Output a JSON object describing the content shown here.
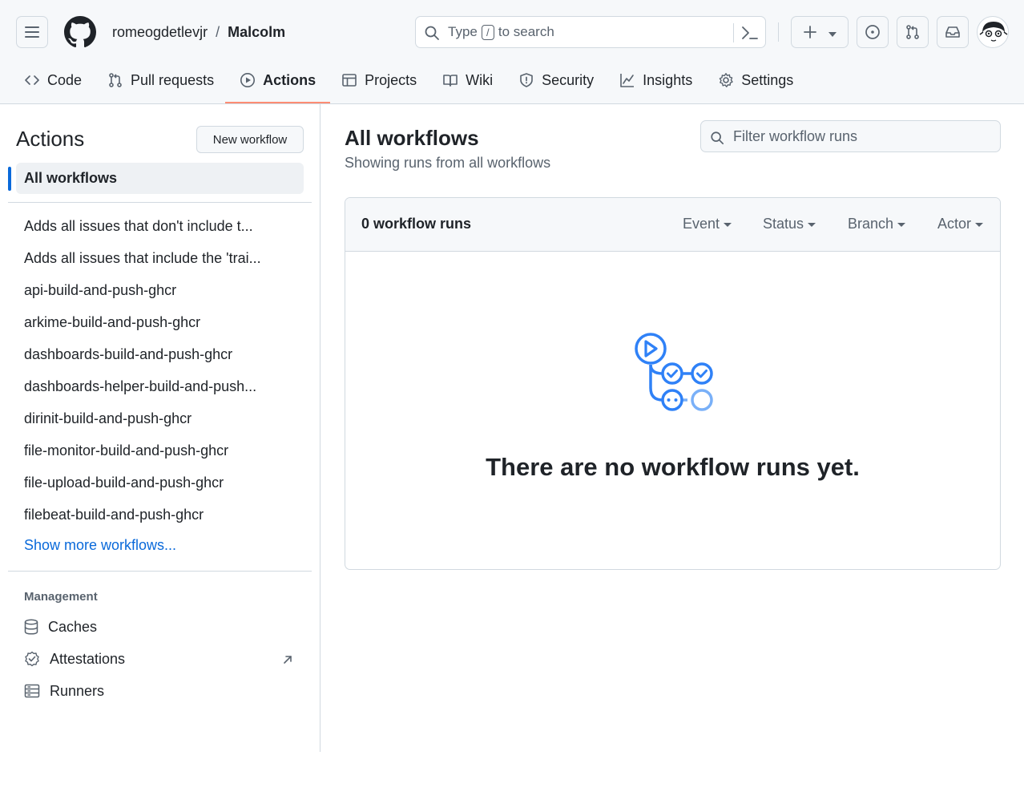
{
  "header": {
    "owner": "romeogdetlevjr",
    "separator": "/",
    "repo": "Malcolm",
    "search": {
      "prefix": "Type",
      "key": "/",
      "suffix": "to search"
    }
  },
  "repo_nav": [
    {
      "label": "Code",
      "icon": "code-icon"
    },
    {
      "label": "Pull requests",
      "icon": "git-pull-request-icon"
    },
    {
      "label": "Actions",
      "icon": "play-icon",
      "active": true
    },
    {
      "label": "Projects",
      "icon": "table-icon"
    },
    {
      "label": "Wiki",
      "icon": "book-icon"
    },
    {
      "label": "Security",
      "icon": "shield-icon"
    },
    {
      "label": "Insights",
      "icon": "graph-icon"
    },
    {
      "label": "Settings",
      "icon": "gear-icon"
    }
  ],
  "sidebar": {
    "title": "Actions",
    "new_workflow": "New workflow",
    "all_workflows": "All workflows",
    "workflows": [
      "Adds all issues that don't include t...",
      "Adds all issues that include the 'trai...",
      "api-build-and-push-ghcr",
      "arkime-build-and-push-ghcr",
      "dashboards-build-and-push-ghcr",
      "dashboards-helper-build-and-push...",
      "dirinit-build-and-push-ghcr",
      "file-monitor-build-and-push-ghcr",
      "file-upload-build-and-push-ghcr",
      "filebeat-build-and-push-ghcr"
    ],
    "show_more": "Show more workflows...",
    "management": {
      "title": "Management",
      "items": [
        {
          "label": "Caches",
          "icon": "database-icon"
        },
        {
          "label": "Attestations",
          "icon": "verified-icon"
        },
        {
          "label": "Runners",
          "icon": "server-icon"
        }
      ]
    }
  },
  "main": {
    "title": "All workflows",
    "subtitle": "Showing runs from all workflows",
    "filter_placeholder": "Filter workflow runs",
    "runs_count": "0 workflow runs",
    "filters": [
      "Event",
      "Status",
      "Branch",
      "Actor"
    ],
    "empty_message": "There are no workflow runs yet."
  },
  "colors": {
    "accent": "#0969da",
    "active_tab_underline": "#fd8c73",
    "illustration": "#2f81f7"
  }
}
